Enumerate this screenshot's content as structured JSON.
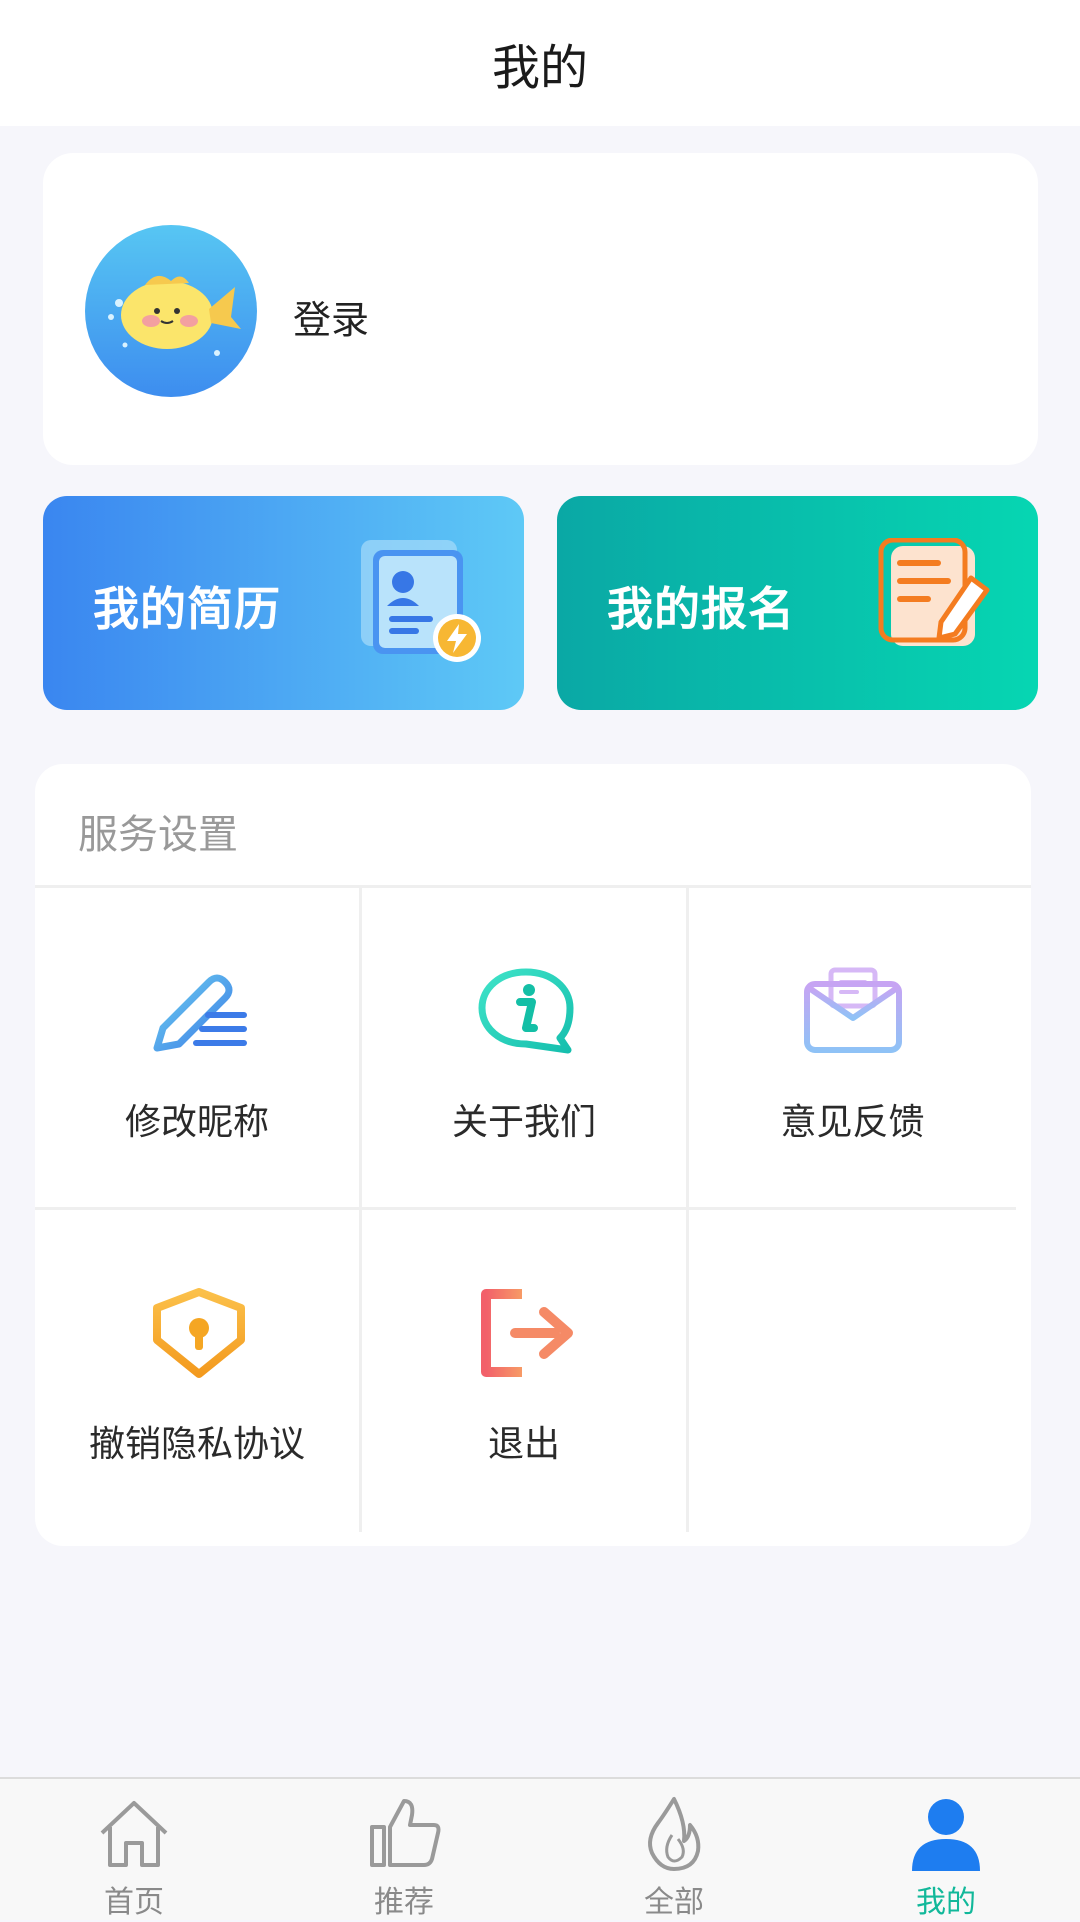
{
  "header": {
    "title": "我的"
  },
  "profile": {
    "login_label": "登录"
  },
  "quick_actions": [
    {
      "label": "我的简历",
      "icon": "resume-icon"
    },
    {
      "label": "我的报名",
      "icon": "signup-icon"
    }
  ],
  "services": {
    "title": "服务设置",
    "items": [
      {
        "label": "修改昵称",
        "icon": "edit-nickname-icon"
      },
      {
        "label": "关于我们",
        "icon": "info-icon"
      },
      {
        "label": "意见反馈",
        "icon": "feedback-mail-icon"
      },
      {
        "label": "撤销隐私协议",
        "icon": "privacy-shield-icon"
      },
      {
        "label": "退出",
        "icon": "logout-icon"
      }
    ]
  },
  "tabbar": {
    "items": [
      {
        "label": "首页",
        "icon": "home-icon"
      },
      {
        "label": "推荐",
        "icon": "thumbs-up-icon"
      },
      {
        "label": "全部",
        "icon": "fire-icon"
      },
      {
        "label": "我的",
        "icon": "user-icon"
      }
    ],
    "active_index": 3
  },
  "colors": {
    "accent": "#12b89a",
    "resume_gradient": [
      "#3a86f0",
      "#5ec9f6"
    ],
    "signup_gradient": [
      "#0aa8a5",
      "#06d6b2"
    ]
  }
}
